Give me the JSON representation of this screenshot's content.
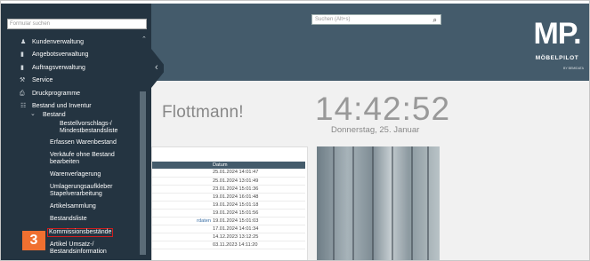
{
  "header": {
    "search_placeholder": "Suchen (Alt+s)",
    "logo_mark": "MP.",
    "logo_name": "MÖBELPILOT",
    "logo_by": "BY BEMIDATA"
  },
  "dashboard": {
    "greeting": "Flottmann!",
    "time": "14:42:52",
    "date": "Donnerstag, 25. Januar",
    "table_header": "Datum",
    "rows": [
      {
        "text": "",
        "date": "25.01.2024 14:01:47"
      },
      {
        "text": "",
        "date": "25.01.2024 13:01:49"
      },
      {
        "text": "",
        "date": "23.01.2024 15:01:36"
      },
      {
        "text": "",
        "date": "19.01.2024 16:01:48"
      },
      {
        "text": "",
        "date": "19.01.2024 15:01:18"
      },
      {
        "text": "",
        "date": "19.01.2024 15:01:56"
      },
      {
        "text": "rdaten",
        "date": "19.01.2024 15:01:03"
      },
      {
        "text": "",
        "date": "17.01.2024 14:01:34"
      },
      {
        "text": "",
        "date": "14.12.2023 13:12:25"
      },
      {
        "text": "",
        "date": "03.11.2023 14:11:20"
      }
    ]
  },
  "sidebar": {
    "search_placeholder": "Formular suchen",
    "items": [
      {
        "label": "Kundenverwaltung"
      },
      {
        "label": "Angebotsverwaltung"
      },
      {
        "label": "Auftragsverwaltung"
      },
      {
        "label": "Service"
      },
      {
        "label": "Druckprogramme"
      },
      {
        "label": "Bestand und Inventur"
      },
      {
        "label": "Bestand"
      },
      {
        "label": "Bestellvorschlags-/\nMindestbestandsliste"
      },
      {
        "label": "Erfassen Warenbestand"
      },
      {
        "label": "Verkäufe ohne Bestand\nbearbeiten"
      },
      {
        "label": "Warenverlagerung"
      },
      {
        "label": "Umlagerungsaufkleber\nStapelverarbeitung"
      },
      {
        "label": "Artikelsammlung"
      },
      {
        "label": "Bestandsliste"
      },
      {
        "label": "Kommissionsbestände"
      },
      {
        "label": "Artikel Umsatz-/\nBestandsinformation"
      }
    ],
    "step_badge": "3"
  }
}
